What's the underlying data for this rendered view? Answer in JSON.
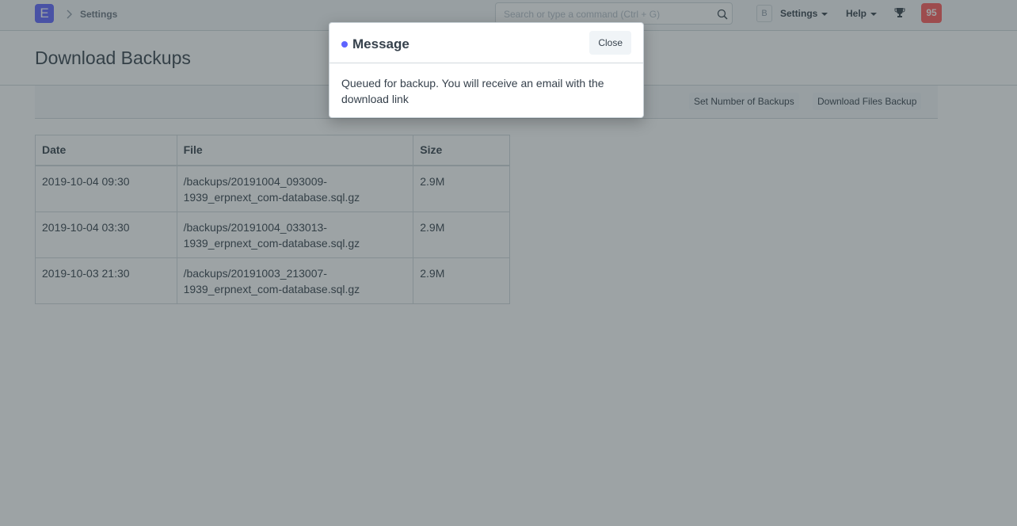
{
  "navbar": {
    "logo_letter": "E",
    "breadcrumb": "Settings",
    "search_placeholder": "Search or type a command (Ctrl + G)",
    "avatar_letter": "B",
    "settings_label": "Settings",
    "help_label": "Help",
    "notification_count": "95"
  },
  "page": {
    "title": "Download Backups"
  },
  "toolbar": {
    "set_number_label": "Set Number of Backups",
    "download_files_label": "Download Files Backup"
  },
  "table": {
    "headers": [
      "Date",
      "File",
      "Size"
    ],
    "rows": [
      {
        "date": "2019-10-04 09:30",
        "file_line1": "/backups/20191004_093009-",
        "file_line2": "1939_erpnext_com-database.sql.gz",
        "size": "2.9M"
      },
      {
        "date": "2019-10-04 03:30",
        "file_line1": "/backups/20191004_033013-",
        "file_line2": "1939_erpnext_com-database.sql.gz",
        "size": "2.9M"
      },
      {
        "date": "2019-10-03 21:30",
        "file_line1": "/backups/20191003_213007-",
        "file_line2": "1939_erpnext_com-database.sql.gz",
        "size": "2.9M"
      }
    ]
  },
  "modal": {
    "title": "Message",
    "close_label": "Close",
    "message": "Queued for backup. You will receive an email with the download link"
  },
  "colors": {
    "brand": "#5e64ff",
    "badge": "#ff5858",
    "overlay": "rgba(50, 62, 66, 0.48)"
  },
  "icons": [
    "chevron-right-icon",
    "search-icon",
    "trophy-icon",
    "caret-down-icon"
  ]
}
